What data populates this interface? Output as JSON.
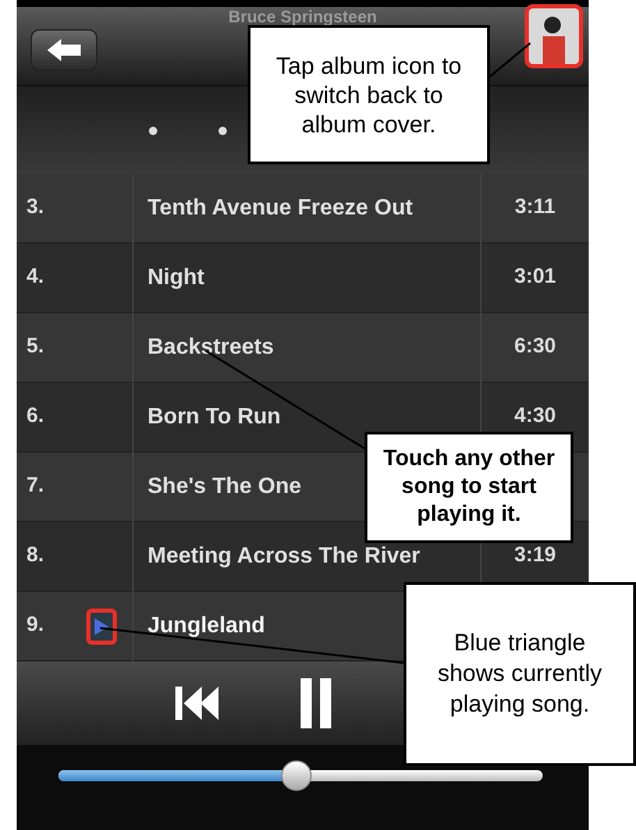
{
  "header": {
    "title": "Bruce Springsteen"
  },
  "tracks": [
    {
      "number": "3.",
      "title": "Tenth Avenue Freeze Out",
      "time": "3:11",
      "playing": false
    },
    {
      "number": "4.",
      "title": "Night",
      "time": "3:01",
      "playing": false
    },
    {
      "number": "5.",
      "title": "Backstreets",
      "time": "6:30",
      "playing": false
    },
    {
      "number": "6.",
      "title": "Born To Run",
      "time": "4:30",
      "playing": false
    },
    {
      "number": "7.",
      "title": "She's The One",
      "playing": false
    },
    {
      "number": "8.",
      "title": "Meeting Across The River",
      "time": "3:19",
      "playing": false
    },
    {
      "number": "9.",
      "title": "Jungleland",
      "playing": true
    }
  ],
  "scrubber": {
    "level": 0.49
  },
  "callouts": [
    {
      "text": "Tap album icon to switch back to album cover."
    },
    {
      "text": "Touch any other song to start playing it."
    },
    {
      "text": "Blue triangle shows currently playing song."
    }
  ]
}
